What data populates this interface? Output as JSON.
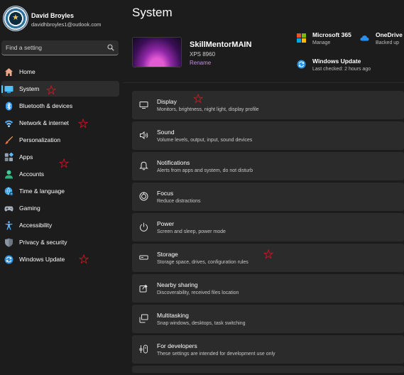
{
  "user": {
    "name": "David Broyles",
    "email": "davidhbroyles1@outlook.com"
  },
  "search": {
    "placeholder": "Find a setting"
  },
  "nav": {
    "items": [
      {
        "label": "Home",
        "icon": "home-icon"
      },
      {
        "label": "System",
        "icon": "monitor-icon",
        "selected": true
      },
      {
        "label": "Bluetooth & devices",
        "icon": "bluetooth-icon"
      },
      {
        "label": "Network & internet",
        "icon": "wifi-icon"
      },
      {
        "label": "Personalization",
        "icon": "brush-icon"
      },
      {
        "label": "Apps",
        "icon": "apps-icon"
      },
      {
        "label": "Accounts",
        "icon": "person-icon"
      },
      {
        "label": "Time & language",
        "icon": "globe-clock-icon"
      },
      {
        "label": "Gaming",
        "icon": "gamepad-icon"
      },
      {
        "label": "Accessibility",
        "icon": "accessibility-icon"
      },
      {
        "label": "Privacy & security",
        "icon": "shield-icon"
      },
      {
        "label": "Windows Update",
        "icon": "sync-icon"
      }
    ]
  },
  "page": {
    "title": "System"
  },
  "device": {
    "name": "SkillMentorMAIN",
    "model": "XPS 8960",
    "rename_label": "Rename"
  },
  "quick_links": {
    "microsoft365": {
      "title": "Microsoft 365",
      "subtitle": "Manage"
    },
    "onedrive": {
      "title": "OneDrive",
      "subtitle": "Backed up"
    },
    "windows_update": {
      "title": "Windows Update",
      "subtitle": "Last checked: 2 hours ago"
    }
  },
  "settings": [
    {
      "title": "Display",
      "subtitle": "Monitors, brightness, night light, display profile",
      "icon": "display-icon"
    },
    {
      "title": "Sound",
      "subtitle": "Volume levels, output, input, sound devices",
      "icon": "speaker-icon"
    },
    {
      "title": "Notifications",
      "subtitle": "Alerts from apps and system, do not disturb",
      "icon": "bell-icon"
    },
    {
      "title": "Focus",
      "subtitle": "Reduce distractions",
      "icon": "focus-icon"
    },
    {
      "title": "Power",
      "subtitle": "Screen and sleep, power mode",
      "icon": "power-icon"
    },
    {
      "title": "Storage",
      "subtitle": "Storage space, drives, configuration rules",
      "icon": "storage-icon"
    },
    {
      "title": "Nearby sharing",
      "subtitle": "Discoverability, received files location",
      "icon": "share-icon"
    },
    {
      "title": "Multitasking",
      "subtitle": "Snap windows, desktops, task switching",
      "icon": "multitask-icon"
    },
    {
      "title": "For developers",
      "subtitle": "These settings are intended for development use only",
      "icon": "developer-icon"
    }
  ],
  "colors": {
    "accent": "#60cdff",
    "rename_link": "#c48be8",
    "annotation_star": "#e81123"
  }
}
